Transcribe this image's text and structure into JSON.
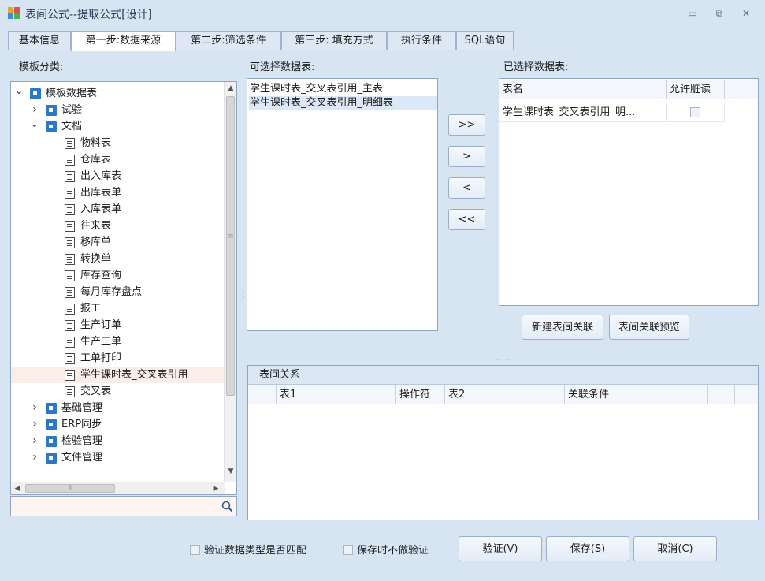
{
  "window": {
    "title": "表间公式--提取公式[设计]",
    "minimize_glyph": "▭",
    "restore_glyph": "⧉",
    "close_glyph": "✕"
  },
  "tabs": [
    {
      "label": "基本信息"
    },
    {
      "label": "第一步:数据来源"
    },
    {
      "label": "第二步:筛选条件"
    },
    {
      "label": "第三步: 填充方式"
    },
    {
      "label": "执行条件"
    },
    {
      "label": "SQL语句"
    }
  ],
  "labels": {
    "template_category": "模板分类:",
    "selectable_tables": "可选择数据表:",
    "selected_tables": "已选择数据表:"
  },
  "tree": {
    "root": "模板数据表",
    "nodes": [
      {
        "label": "试验",
        "type": "folder",
        "level": 1,
        "expanded": false
      },
      {
        "label": "文档",
        "type": "folder",
        "level": 1,
        "expanded": true
      },
      {
        "label": "物料表",
        "type": "doc",
        "level": 2
      },
      {
        "label": "仓库表",
        "type": "doc",
        "level": 2
      },
      {
        "label": "出入库表",
        "type": "doc",
        "level": 2
      },
      {
        "label": "出库表单",
        "type": "doc",
        "level": 2
      },
      {
        "label": "入库表单",
        "type": "doc",
        "level": 2
      },
      {
        "label": "往来表",
        "type": "doc",
        "level": 2
      },
      {
        "label": "移库单",
        "type": "doc",
        "level": 2
      },
      {
        "label": "转换单",
        "type": "doc",
        "level": 2
      },
      {
        "label": "库存查询",
        "type": "doc",
        "level": 2
      },
      {
        "label": "每月库存盘点",
        "type": "doc",
        "level": 2
      },
      {
        "label": "报工",
        "type": "doc",
        "level": 2
      },
      {
        "label": "生产订单",
        "type": "doc",
        "level": 2
      },
      {
        "label": "生产工单",
        "type": "doc",
        "level": 2
      },
      {
        "label": "工单打印",
        "type": "doc",
        "level": 2
      },
      {
        "label": "学生课时表_交叉表引用",
        "type": "doc",
        "level": 2,
        "selected": true
      },
      {
        "label": "交叉表",
        "type": "doc",
        "level": 2
      },
      {
        "label": "基础管理",
        "type": "folder",
        "level": 1,
        "expanded": false
      },
      {
        "label": "ERP同步",
        "type": "folder",
        "level": 1,
        "expanded": false
      },
      {
        "label": "检验管理",
        "type": "folder",
        "level": 1,
        "expanded": false
      },
      {
        "label": "文件管理",
        "type": "folder",
        "level": 1,
        "expanded": false
      }
    ]
  },
  "search": {
    "value": "",
    "icon": "search-icon"
  },
  "available_tables": [
    {
      "label": "学生课时表_交叉表引用_主表",
      "selected": false
    },
    {
      "label": "学生课时表_交叉表引用_明细表",
      "selected": true
    }
  ],
  "transfer_buttons": {
    "add_all": ">>",
    "add": ">",
    "remove": "<",
    "remove_all": "<<"
  },
  "selected_grid": {
    "columns": [
      "表名",
      "允许脏读"
    ],
    "rows": [
      {
        "name": "学生课时表_交叉表引用_明...",
        "dirty_read": false
      }
    ]
  },
  "relation_buttons": {
    "new": "新建表间关联",
    "preview": "表间关联预览"
  },
  "relations": {
    "title": "表间关系",
    "columns": [
      "表1",
      "操作符",
      "表2",
      "关联条件"
    ]
  },
  "footer": {
    "check_type": "验证数据类型是否匹配",
    "no_validate": "保存时不做验证",
    "validate_btn": "验证(V)",
    "save_btn": "保存(S)",
    "cancel_btn": "取消(C)"
  },
  "colors": {
    "window_bg": "#d7e4f2",
    "folder_blue": "#2c78c8",
    "tree_selected": "#fbeee8",
    "list_selected": "#dbe8f7"
  }
}
